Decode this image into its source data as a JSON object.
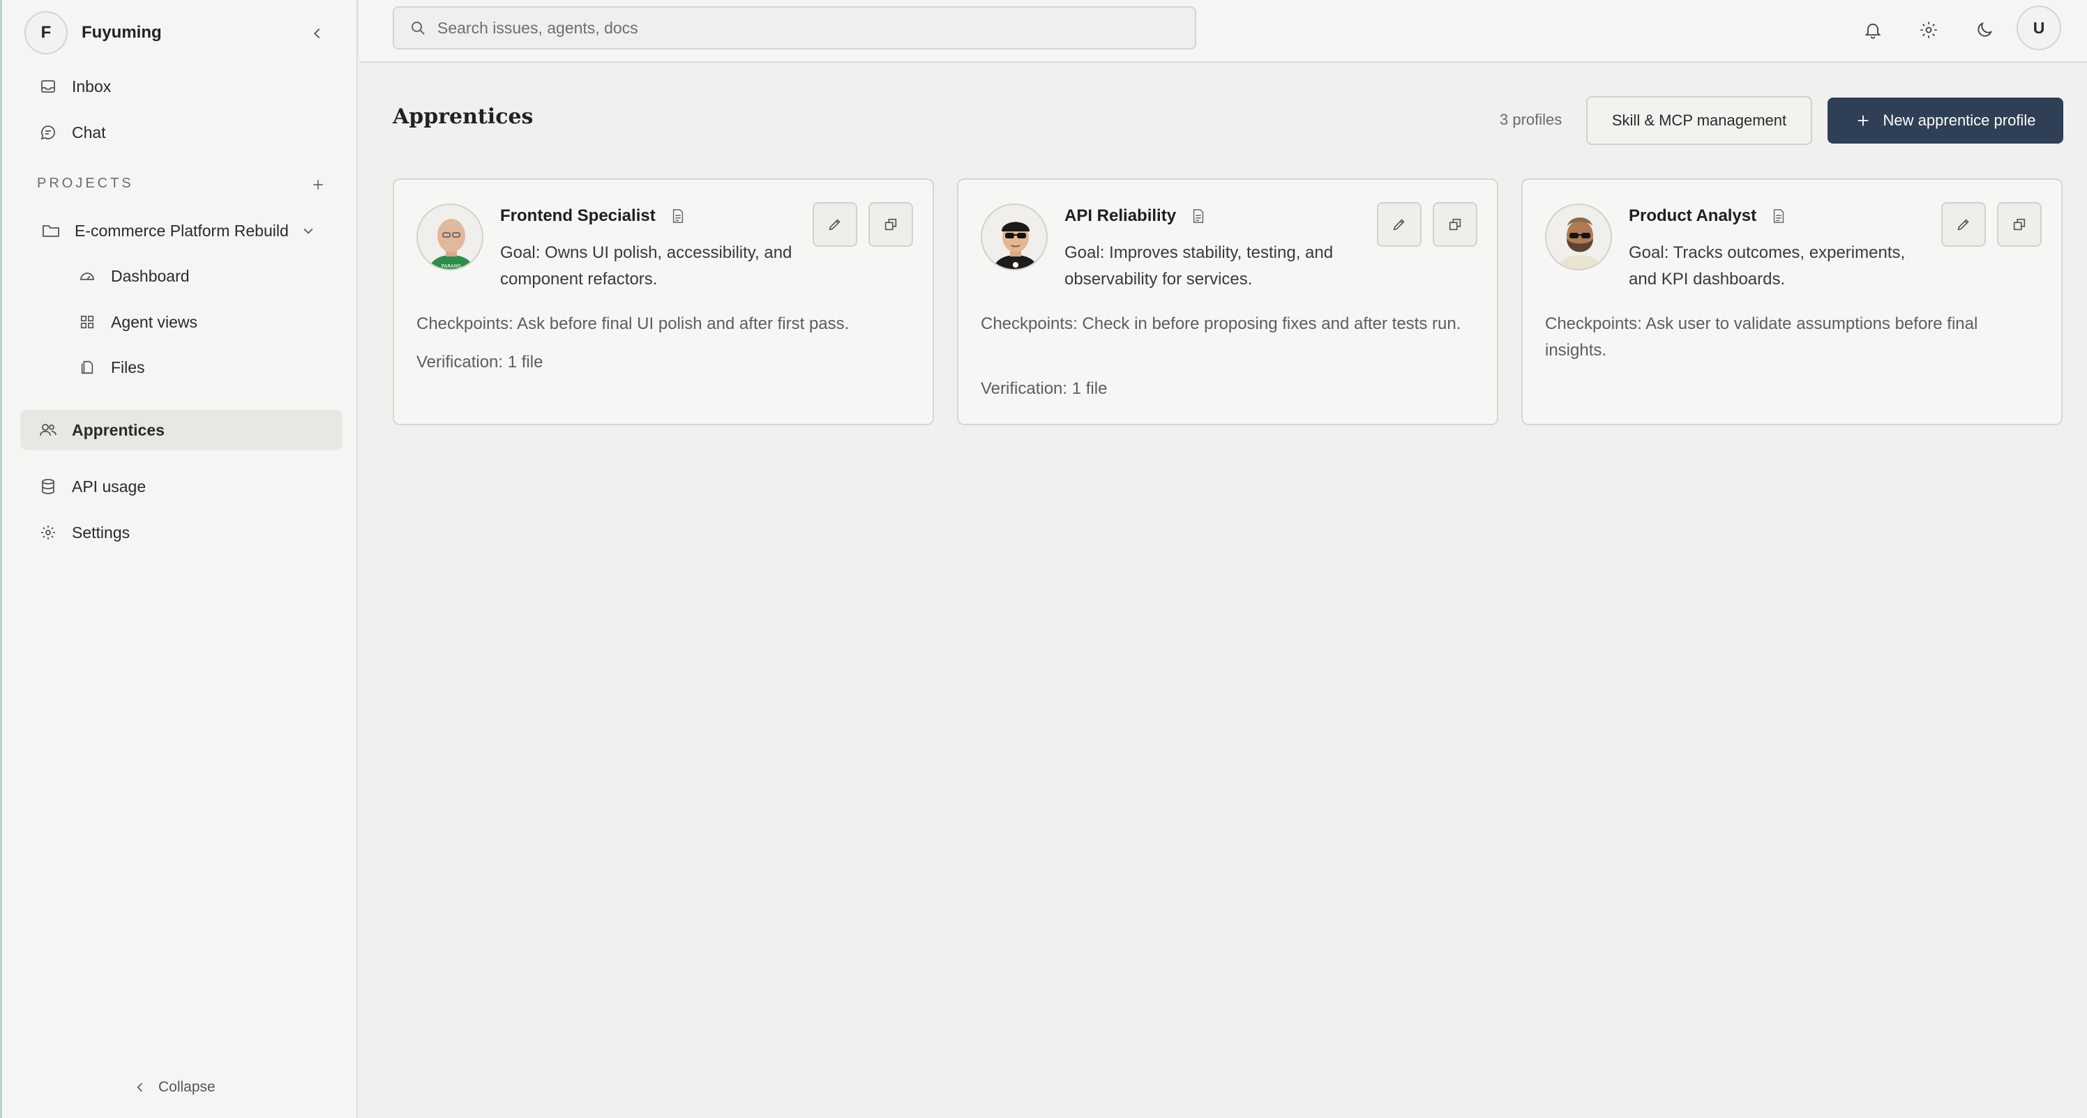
{
  "workspace": {
    "initial": "F",
    "name": "Fuyuming"
  },
  "nav": {
    "inbox": "Inbox",
    "chat": "Chat",
    "projects_label": "PROJECTS",
    "project": {
      "name": "E-commerce Platform Rebuild",
      "items": [
        "Dashboard",
        "Agent views",
        "Files"
      ]
    },
    "apprentices": "Apprentices",
    "api_usage": "API usage",
    "settings": "Settings",
    "collapse": "Collapse"
  },
  "search": {
    "placeholder": "Search issues, agents, docs",
    "value": ""
  },
  "user": {
    "initial": "U"
  },
  "page": {
    "title": "Apprentices",
    "profiles_count": "3 profiles",
    "skill_button": "Skill & MCP management",
    "new_button": "New apprentice profile"
  },
  "colors": {
    "primary": "#2f3f55",
    "sidebar_bg": "#f6f5f3",
    "main_bg": "#f1f0ee",
    "active_nav": "#e9e7e3"
  },
  "profiles": [
    {
      "name": "Frontend Specialist",
      "goal": "Goal: Owns UI polish, accessibility, and component refactors.",
      "checkpoints": "Checkpoints: Ask before final UI polish and after first pass.",
      "verification": "Verification: 1 file",
      "avatar_icon": "avatar-bald-green-shirt-icon"
    },
    {
      "name": "API Reliability",
      "goal": "Goal: Improves stability, testing, and observability for services.",
      "checkpoints": "Checkpoints: Check in before proposing fixes and after tests run.",
      "verification": "Verification: 1 file",
      "avatar_icon": "avatar-sunglasses-cap-icon"
    },
    {
      "name": "Product Analyst",
      "goal": "Goal: Tracks outcomes, experiments, and KPI dashboards.",
      "checkpoints": "Checkpoints: Ask user to validate assumptions before final insights.",
      "verification": "",
      "avatar_icon": "avatar-bearded-sunglasses-icon"
    }
  ]
}
